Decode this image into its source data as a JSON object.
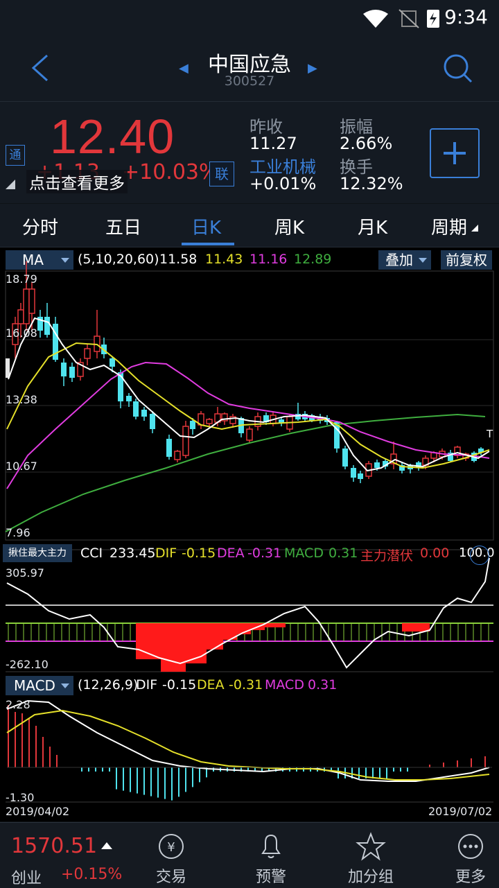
{
  "status_bar": {
    "time": "9:34"
  },
  "header": {
    "title": "中国应急",
    "code": "300527"
  },
  "quote": {
    "price": "12.40",
    "change": "+1.13",
    "change_pct": "+10.03%",
    "tong_badge": "通",
    "lian_badge": "联",
    "tooltip": "点击查看更多",
    "prev_close_label": "昨收",
    "prev_close": "11.27",
    "amplitude_label": "振幅",
    "amplitude": "2.66%",
    "industry": "工业机械",
    "industry_change": "+0.01%",
    "turnover_label": "换手",
    "turnover": "12.32%"
  },
  "tabs": [
    {
      "label": "分时"
    },
    {
      "label": "五日"
    },
    {
      "label": "日K",
      "active": true
    },
    {
      "label": "周K"
    },
    {
      "label": "月K"
    },
    {
      "label": "周期"
    }
  ],
  "ma_bar": {
    "indicator": "MA",
    "params": "(5,10,20,60)",
    "v5": "11.58",
    "v10": "11.43",
    "v20": "11.16",
    "v60": "12.89",
    "overlay": "叠加",
    "adjust": "前复权",
    "colors": {
      "ma5": "#ffffff",
      "ma10": "#e5e02a",
      "ma20": "#e03ce0",
      "ma60": "#3fae3f"
    }
  },
  "price_axis": {
    "top": "18.79",
    "l2": "16.08",
    "l3": "13.38",
    "l4": "10.67",
    "bottom": "7.96"
  },
  "t_marker": "T",
  "cci_bar": {
    "indicator": "揪住最大主力",
    "cci_label": "CCI",
    "cci": "233.45",
    "dif_label": "DIF",
    "dif": "-0.15",
    "dea_label": "DEA",
    "dea": "-0.31",
    "macd_label": "MACD",
    "macd": "0.31",
    "zl_label": "主力潜伏",
    "zl": "0.00",
    "extra": "100.0",
    "axis_top": "305.97",
    "axis_bottom": "-262.10"
  },
  "macd_bar": {
    "indicator": "MACD",
    "params": "(12,26,9)",
    "dif_label": "DIF",
    "dif": "-0.15",
    "dea_label": "DEA",
    "dea": "-0.31",
    "macd_label": "MACD",
    "macd": "0.31",
    "axis_top": "2.28",
    "axis_bottom": "-1.30"
  },
  "dates": {
    "start": "2019/04/02",
    "end": "2019/07/02"
  },
  "bottom_nav": {
    "index_value": "1570.51",
    "index_name": "创业",
    "index_change": "+0.15%",
    "items": [
      {
        "label": "交易",
        "icon": "trade-icon"
      },
      {
        "label": "预警",
        "icon": "bell-icon"
      },
      {
        "label": "加分组",
        "icon": "star-icon"
      },
      {
        "label": "更多",
        "icon": "more-icon"
      }
    ]
  }
}
